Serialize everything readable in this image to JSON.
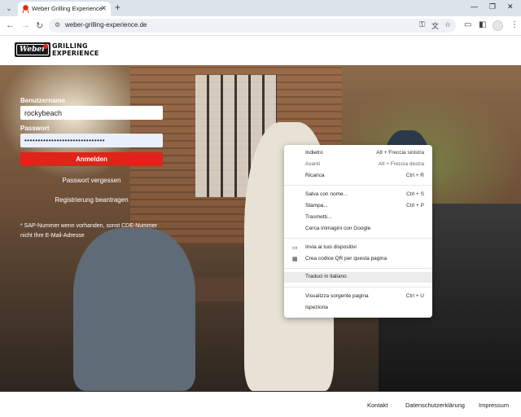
{
  "browser": {
    "tab_title": "Weber Grilling Experience",
    "tab_close": "✕",
    "new_tab": "+",
    "url": "weber-grilling-experience.de"
  },
  "site": {
    "logo_text_line1": "GRILLING",
    "logo_text_line2": "EXPERIENCE",
    "logo_word": "Weber"
  },
  "login": {
    "username_label": "Benutzername",
    "username_value": "rockybeach",
    "password_label": "Passwort",
    "password_value": "••••••••••••••••••••••••••••••",
    "login_button": "Anmelden",
    "forgot_link": "Passwort vergessen",
    "register_link": "Registrierung beantragen",
    "hint_line1": "* SAP-Nummer wenn vorhanden, sonst CDE-Nummer",
    "hint_line2": "nicht Ihre E-Mail-Adresse"
  },
  "context_menu": {
    "items": [
      {
        "label": "Indietro",
        "shortcut": "Alt + Freccia sinistra"
      },
      {
        "label": "Avanti",
        "shortcut": "Alt + Freccia destra"
      },
      {
        "label": "Ricarica",
        "shortcut": "Ctrl + R"
      },
      {
        "label": "Salva con nome...",
        "shortcut": "Ctrl + S"
      },
      {
        "label": "Stampa...",
        "shortcut": "Ctrl + P"
      },
      {
        "label": "Trasmetti...",
        "shortcut": ""
      },
      {
        "label": "Cerca immagini con Google",
        "shortcut": ""
      },
      {
        "label": "Invia ai tuoi dispositivi",
        "shortcut": ""
      },
      {
        "label": "Crea codice QR per questa pagina",
        "shortcut": ""
      },
      {
        "label": "Traduci in italiano",
        "shortcut": ""
      },
      {
        "label": "Visualizza sorgente pagina",
        "shortcut": "Ctrl + U"
      },
      {
        "label": "Ispeziona",
        "shortcut": ""
      }
    ]
  },
  "footer": {
    "kontakt": "Kontakt",
    "datenschutz": "Datenschutzerklärung",
    "impressum": "Impressum"
  },
  "colors": {
    "accent_red": "#e2231a",
    "tabstrip": "#dde3ea"
  }
}
